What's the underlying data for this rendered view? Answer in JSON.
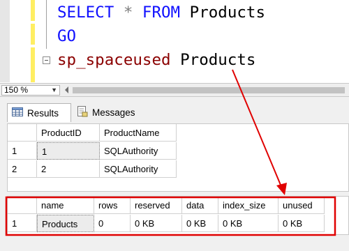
{
  "editor": {
    "line1": {
      "kw1": "SELECT",
      "op": "*",
      "kw2": "FROM",
      "table": "Products"
    },
    "line2": {
      "kw": "GO"
    },
    "line3": {
      "proc": "sp_spaceused",
      "arg": "Products"
    }
  },
  "zoom": {
    "value": "150 %"
  },
  "tabs": [
    {
      "label": "Results",
      "icon": "grid-icon"
    },
    {
      "label": "Messages",
      "icon": "messages-icon"
    }
  ],
  "grid1": {
    "columns": [
      "ProductID",
      "ProductName"
    ],
    "rows": [
      {
        "num": "1",
        "cells": [
          "1",
          "SQLAuthority"
        ]
      },
      {
        "num": "2",
        "cells": [
          "2",
          "SQLAuthority"
        ]
      }
    ]
  },
  "grid2": {
    "columns": [
      "name",
      "rows",
      "reserved",
      "data",
      "index_size",
      "unused"
    ],
    "rows": [
      {
        "num": "1",
        "cells": [
          "Products",
          "0",
          "0 KB",
          "0 KB",
          "0 KB",
          "0 KB"
        ]
      }
    ]
  },
  "colors": {
    "annotation": "#e00000",
    "keyword": "#1010ff",
    "system_proc": "#8b0000"
  }
}
